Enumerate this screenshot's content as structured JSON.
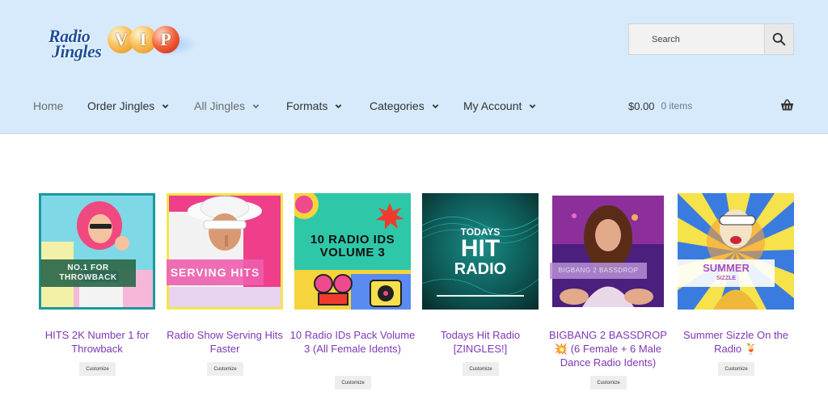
{
  "brand": {
    "logo_line1": "Radio",
    "logo_line2": "Jingles",
    "logo_vip": [
      "V",
      "I",
      "P"
    ]
  },
  "search": {
    "placeholder": "Search"
  },
  "nav": {
    "home": "Home",
    "order_jingles": "Order Jingles",
    "all_jingles": "All Jingles",
    "formats": "Formats",
    "categories": "Categories",
    "my_account": "My Account"
  },
  "cart": {
    "amount": "$0.00",
    "count": "0 items"
  },
  "products": [
    {
      "title": "HITS 2K Number 1 for Throwback",
      "thumb_text": "NO.1 FOR THROWBACK",
      "button": "Customize"
    },
    {
      "title": "Radio Show Serving Hits Faster",
      "thumb_text": "SERVING HITS",
      "button": "Customize"
    },
    {
      "title": "10 Radio IDs Pack Volume 3 (All Female Idents)",
      "thumb_text_1": "10 RADIO IDS",
      "thumb_text_2": "VOLUME 3",
      "button": "Customize"
    },
    {
      "title": "Todays Hit Radio [ZINGLES!]",
      "thumb_text_1": "TODAYS",
      "thumb_text_2": "HIT",
      "thumb_text_3": "RADIO",
      "button": "Customize"
    },
    {
      "title": "BIGBANG 2 BASSDROP 💥 (6 Female + 6 Male Dance Radio Idents)",
      "thumb_text": "BIGBANG 2 BASSDROP",
      "button": "Customize"
    },
    {
      "title": "Summer Sizzle On the Radio 🍹",
      "thumb_text_1": "SUMMER",
      "thumb_text_2": "SIZZLE",
      "button": "Customize"
    }
  ],
  "colors": {
    "header_bg": "#d6eafb",
    "product_link": "#7e38b5",
    "text": "#333333"
  }
}
